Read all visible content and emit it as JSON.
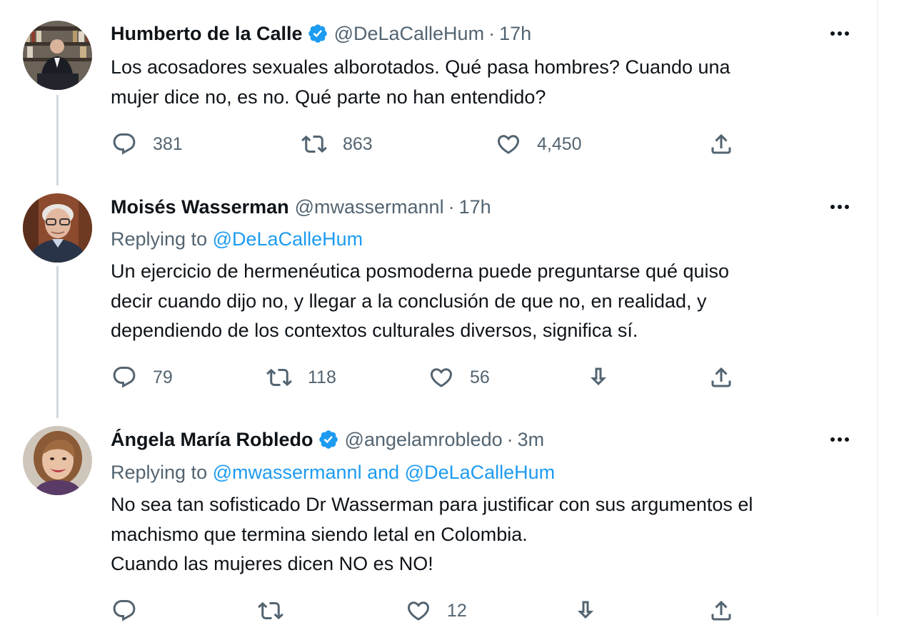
{
  "tweets": [
    {
      "name": "Humberto de la Calle",
      "verified": true,
      "handle": "@DeLaCalleHum",
      "separator": "·",
      "time": "17h",
      "replying_to": null,
      "text_lines": [
        "Los acosadores sexuales alborotados. Qué pasa hombres? Cuando una",
        "mujer dice no, es no. Qué parte no han entendido?"
      ],
      "actions": {
        "reply": "381",
        "retweet": "863",
        "like": "4,450"
      },
      "icons": [
        "reply-icon",
        "retweet-icon",
        "like-icon",
        "share-icon"
      ]
    },
    {
      "name": "Moisés Wasserman",
      "verified": false,
      "handle": "@mwassermannl",
      "separator": "·",
      "time": "17h",
      "replying_to": {
        "prefix": "Replying to",
        "links": [
          "@DeLaCalleHum"
        ]
      },
      "text_lines": [
        "Un ejercicio de hermenéutica posmoderna puede preguntarse qué quiso",
        "decir cuando dijo no, y llegar a la conclusión de que no, en realidad, y",
        "dependiendo de los contextos culturales diversos, significa sí."
      ],
      "actions": {
        "reply": "79",
        "retweet": "118",
        "like": "56"
      },
      "icons": [
        "reply-icon",
        "retweet-icon",
        "like-icon",
        "downvote-icon",
        "share-icon"
      ]
    },
    {
      "name": "Ángela María Robledo",
      "verified": true,
      "handle": "@angelamrobledo",
      "separator": "·",
      "time": "3m",
      "replying_to": {
        "prefix": "Replying to",
        "links": [
          "@mwassermannl",
          "@DeLaCalleHum"
        ],
        "joiner": "and"
      },
      "text_lines": [
        "No sea tan sofisticado Dr Wasserman para  justificar con sus argumentos el",
        "machismo que termina siendo letal en Colombia.",
        "Cuando las mujeres dicen NO es NO!"
      ],
      "actions": {
        "reply": "",
        "retweet": "",
        "like": "12"
      },
      "icons": [
        "reply-icon",
        "retweet-icon",
        "like-icon",
        "downvote-icon",
        "share-icon"
      ]
    }
  ],
  "colors": {
    "text": "#0f1419",
    "secondary": "#536471",
    "link": "#1d9bf0",
    "verified": "#1d9bf0",
    "thread_line": "#cfd9de"
  }
}
